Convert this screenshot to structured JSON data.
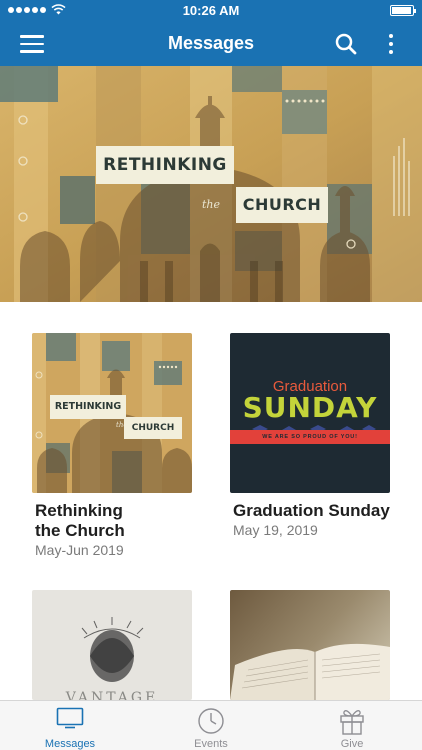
{
  "status_bar": {
    "time": "10:26 AM",
    "battery_level": 0.95
  },
  "navbar": {
    "title": "Messages",
    "menu_icon": "hamburger-icon",
    "search_icon": "search-icon",
    "more_icon": "more-vertical-icon",
    "color": "#1a72b3"
  },
  "hero": {
    "title_line1": "RETHINKING",
    "title_the": "the",
    "title_line2": "CHURCH"
  },
  "series": [
    {
      "title": "Rethinking the Church",
      "title_line1": "Rethinking",
      "title_line2": "the Church",
      "date": "May-Jun 2019",
      "thumb_line1": "RETHINKING",
      "thumb_the": "the",
      "thumb_line2": "CHURCH"
    },
    {
      "title": "Graduation Sunday",
      "date": "May 19, 2019",
      "thumb_top": "Graduation",
      "thumb_main": "SUNDAY",
      "thumb_banner": "WE ARE SO PROUD OF YOU!"
    },
    {
      "thumb_text": "VANTAGE"
    },
    {}
  ],
  "tabbar": {
    "tabs": [
      {
        "label": "Messages",
        "icon": "tv-icon",
        "active": true
      },
      {
        "label": "Events",
        "icon": "clock-icon",
        "active": false
      },
      {
        "label": "Give",
        "icon": "gift-icon",
        "active": false
      }
    ],
    "active_color": "#1a72b3"
  }
}
